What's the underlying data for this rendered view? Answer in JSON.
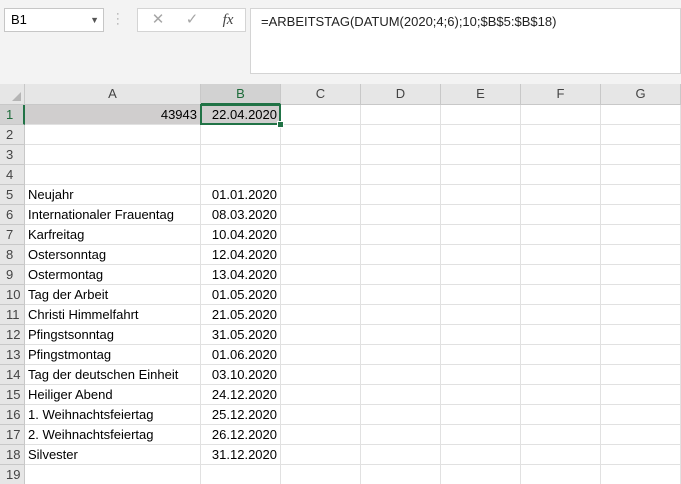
{
  "name_box": {
    "value": "B1"
  },
  "formula_bar": {
    "cancel_icon": "✕",
    "enter_icon": "✓",
    "fx_label": "fx",
    "formula": "=ARBEITSTAG(DATUM(2020;4;6);10;$B$5:$B$18)"
  },
  "columns": [
    "A",
    "B",
    "C",
    "D",
    "E",
    "F",
    "G"
  ],
  "selected_column": "B",
  "selected_row": 1,
  "rows": [
    {
      "num": "1",
      "a": "43943",
      "b": "22.04.2020"
    },
    {
      "num": "2",
      "a": "",
      "b": ""
    },
    {
      "num": "3",
      "a": "",
      "b": ""
    },
    {
      "num": "4",
      "a": "",
      "b": ""
    },
    {
      "num": "5",
      "a": "Neujahr",
      "b": "01.01.2020"
    },
    {
      "num": "6",
      "a": "Internationaler Frauentag",
      "b": "08.03.2020"
    },
    {
      "num": "7",
      "a": "Karfreitag",
      "b": "10.04.2020"
    },
    {
      "num": "8",
      "a": "Ostersonntag",
      "b": "12.04.2020"
    },
    {
      "num": "9",
      "a": "Ostermontag",
      "b": "13.04.2020"
    },
    {
      "num": "10",
      "a": "Tag der Arbeit",
      "b": "01.05.2020"
    },
    {
      "num": "11",
      "a": "Christi Himmelfahrt",
      "b": "21.05.2020"
    },
    {
      "num": "12",
      "a": "Pfingstsonntag",
      "b": "31.05.2020"
    },
    {
      "num": "13",
      "a": "Pfingstmontag",
      "b": "01.06.2020"
    },
    {
      "num": "14",
      "a": "Tag der deutschen Einheit",
      "b": "03.10.2020"
    },
    {
      "num": "15",
      "a": "Heiliger Abend",
      "b": "24.12.2020"
    },
    {
      "num": "16",
      "a": "1. Weihnachtsfeiertag",
      "b": "25.12.2020"
    },
    {
      "num": "17",
      "a": "2. Weihnachtsfeiertag",
      "b": "26.12.2020"
    },
    {
      "num": "18",
      "a": "Silvester",
      "b": "31.12.2020"
    },
    {
      "num": "19",
      "a": "",
      "b": ""
    }
  ],
  "colors": {
    "accent": "#217346",
    "gray_fill": "#d0cece",
    "header_bg": "#e6e6e6"
  }
}
